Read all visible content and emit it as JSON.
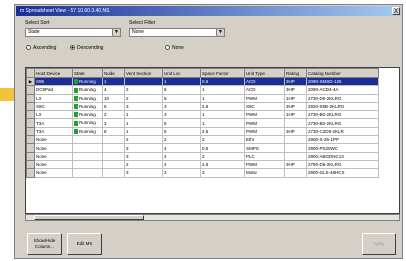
{
  "window": {
    "title": "m Spreadsheet View - 57 10.60.3.40.NS",
    "close_label": "X"
  },
  "filters": {
    "sort_label": "Select Sort",
    "sort_value": "State",
    "filter_label": "Select Filter",
    "filter_value": "None",
    "order": [
      {
        "label": "Ascending",
        "checked": false
      },
      {
        "label": "Descending",
        "checked": true
      },
      {
        "label": "None",
        "checked": false
      }
    ]
  },
  "table": {
    "columns": [
      "Host Device",
      "State",
      "Node",
      "Vent Section",
      "Unit Loc",
      "Space Factor",
      "Unit Type",
      "Rating",
      "Catalog Number"
    ],
    "rows": [
      {
        "selected": true,
        "marker": "▶",
        "cells": [
          "S95",
          "Running",
          "1",
          "",
          "1",
          "0.5",
          "ACD",
          "3HP",
          "2090-SMSD-125"
        ]
      },
      {
        "selected": false,
        "marker": "",
        "cells": [
          "DC9Pad",
          "Running",
          "4",
          "2",
          "6",
          "1",
          "ACD",
          "3HP",
          "2090-ACD4-4A"
        ]
      },
      {
        "selected": false,
        "marker": "",
        "cells": [
          "L3",
          "Running",
          "10",
          "2",
          "5",
          "1",
          "PWM",
          "1HP",
          "2730-D0-2KLRG"
        ]
      },
      {
        "selected": false,
        "marker": "",
        "cells": [
          "S9C",
          "Running",
          "5",
          "3",
          "3",
          "2.5",
          "S9C",
          "3HP",
          "2920-S9B-2KLRG"
        ]
      },
      {
        "selected": false,
        "marker": "",
        "cells": [
          "L3",
          "Running",
          "2",
          "1",
          "3",
          "1",
          "PWM",
          "1HP",
          "2730-B0-2KLRG"
        ]
      },
      {
        "selected": false,
        "marker": "",
        "cells": [
          "T3A",
          "Running",
          "3",
          "1",
          "5",
          "1",
          "PWM",
          "",
          "2730-B0-2KLRG"
        ]
      },
      {
        "selected": false,
        "marker": "",
        "cells": [
          "T3A",
          "Running",
          "8",
          "1",
          "5",
          "2.5",
          "PWM",
          "3HP",
          "2730-C2D8-2KLR"
        ]
      },
      {
        "selected": false,
        "marker": "",
        "cells": [
          "None",
          "",
          "",
          "2",
          "2",
          "2",
          "Ethr",
          "",
          "2900-S-25-1PP"
        ]
      },
      {
        "selected": false,
        "marker": "",
        "cells": [
          "None",
          "",
          "",
          "3",
          "4",
          "0.5",
          "SMPS",
          "",
          "2900-PS20WC"
        ]
      },
      {
        "selected": false,
        "marker": "",
        "cells": [
          "None",
          "",
          "",
          "3",
          "4",
          "2",
          "PLC",
          "",
          "2900-ABGDNC13"
        ]
      },
      {
        "selected": false,
        "marker": "",
        "cells": [
          "None",
          "",
          "",
          "2",
          "4",
          "2.5",
          "PWM",
          "3HP",
          "2790-D6-2KLRG"
        ]
      },
      {
        "selected": false,
        "marker": "",
        "cells": [
          "None",
          "",
          "",
          "3",
          "2",
          "3",
          "Motw",
          "",
          "2900-GLS-48HCS"
        ]
      }
    ]
  },
  "buttons": {
    "show_hide": "Show/Hide Column...",
    "edit": "Edit MS",
    "apply": "Apply"
  }
}
